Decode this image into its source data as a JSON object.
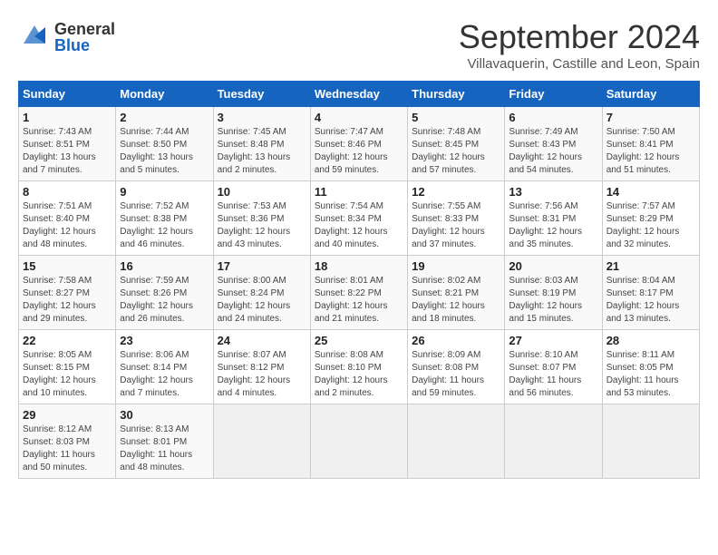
{
  "header": {
    "logo_general": "General",
    "logo_blue": "Blue",
    "month_title": "September 2024",
    "subtitle": "Villavaquerin, Castille and Leon, Spain"
  },
  "days_of_week": [
    "Sunday",
    "Monday",
    "Tuesday",
    "Wednesday",
    "Thursday",
    "Friday",
    "Saturday"
  ],
  "weeks": [
    [
      {
        "day": "1",
        "sunrise": "Sunrise: 7:43 AM",
        "sunset": "Sunset: 8:51 PM",
        "daylight": "Daylight: 13 hours and 7 minutes."
      },
      {
        "day": "2",
        "sunrise": "Sunrise: 7:44 AM",
        "sunset": "Sunset: 8:50 PM",
        "daylight": "Daylight: 13 hours and 5 minutes."
      },
      {
        "day": "3",
        "sunrise": "Sunrise: 7:45 AM",
        "sunset": "Sunset: 8:48 PM",
        "daylight": "Daylight: 13 hours and 2 minutes."
      },
      {
        "day": "4",
        "sunrise": "Sunrise: 7:47 AM",
        "sunset": "Sunset: 8:46 PM",
        "daylight": "Daylight: 12 hours and 59 minutes."
      },
      {
        "day": "5",
        "sunrise": "Sunrise: 7:48 AM",
        "sunset": "Sunset: 8:45 PM",
        "daylight": "Daylight: 12 hours and 57 minutes."
      },
      {
        "day": "6",
        "sunrise": "Sunrise: 7:49 AM",
        "sunset": "Sunset: 8:43 PM",
        "daylight": "Daylight: 12 hours and 54 minutes."
      },
      {
        "day": "7",
        "sunrise": "Sunrise: 7:50 AM",
        "sunset": "Sunset: 8:41 PM",
        "daylight": "Daylight: 12 hours and 51 minutes."
      }
    ],
    [
      {
        "day": "8",
        "sunrise": "Sunrise: 7:51 AM",
        "sunset": "Sunset: 8:40 PM",
        "daylight": "Daylight: 12 hours and 48 minutes."
      },
      {
        "day": "9",
        "sunrise": "Sunrise: 7:52 AM",
        "sunset": "Sunset: 8:38 PM",
        "daylight": "Daylight: 12 hours and 46 minutes."
      },
      {
        "day": "10",
        "sunrise": "Sunrise: 7:53 AM",
        "sunset": "Sunset: 8:36 PM",
        "daylight": "Daylight: 12 hours and 43 minutes."
      },
      {
        "day": "11",
        "sunrise": "Sunrise: 7:54 AM",
        "sunset": "Sunset: 8:34 PM",
        "daylight": "Daylight: 12 hours and 40 minutes."
      },
      {
        "day": "12",
        "sunrise": "Sunrise: 7:55 AM",
        "sunset": "Sunset: 8:33 PM",
        "daylight": "Daylight: 12 hours and 37 minutes."
      },
      {
        "day": "13",
        "sunrise": "Sunrise: 7:56 AM",
        "sunset": "Sunset: 8:31 PM",
        "daylight": "Daylight: 12 hours and 35 minutes."
      },
      {
        "day": "14",
        "sunrise": "Sunrise: 7:57 AM",
        "sunset": "Sunset: 8:29 PM",
        "daylight": "Daylight: 12 hours and 32 minutes."
      }
    ],
    [
      {
        "day": "15",
        "sunrise": "Sunrise: 7:58 AM",
        "sunset": "Sunset: 8:27 PM",
        "daylight": "Daylight: 12 hours and 29 minutes."
      },
      {
        "day": "16",
        "sunrise": "Sunrise: 7:59 AM",
        "sunset": "Sunset: 8:26 PM",
        "daylight": "Daylight: 12 hours and 26 minutes."
      },
      {
        "day": "17",
        "sunrise": "Sunrise: 8:00 AM",
        "sunset": "Sunset: 8:24 PM",
        "daylight": "Daylight: 12 hours and 24 minutes."
      },
      {
        "day": "18",
        "sunrise": "Sunrise: 8:01 AM",
        "sunset": "Sunset: 8:22 PM",
        "daylight": "Daylight: 12 hours and 21 minutes."
      },
      {
        "day": "19",
        "sunrise": "Sunrise: 8:02 AM",
        "sunset": "Sunset: 8:21 PM",
        "daylight": "Daylight: 12 hours and 18 minutes."
      },
      {
        "day": "20",
        "sunrise": "Sunrise: 8:03 AM",
        "sunset": "Sunset: 8:19 PM",
        "daylight": "Daylight: 12 hours and 15 minutes."
      },
      {
        "day": "21",
        "sunrise": "Sunrise: 8:04 AM",
        "sunset": "Sunset: 8:17 PM",
        "daylight": "Daylight: 12 hours and 13 minutes."
      }
    ],
    [
      {
        "day": "22",
        "sunrise": "Sunrise: 8:05 AM",
        "sunset": "Sunset: 8:15 PM",
        "daylight": "Daylight: 12 hours and 10 minutes."
      },
      {
        "day": "23",
        "sunrise": "Sunrise: 8:06 AM",
        "sunset": "Sunset: 8:14 PM",
        "daylight": "Daylight: 12 hours and 7 minutes."
      },
      {
        "day": "24",
        "sunrise": "Sunrise: 8:07 AM",
        "sunset": "Sunset: 8:12 PM",
        "daylight": "Daylight: 12 hours and 4 minutes."
      },
      {
        "day": "25",
        "sunrise": "Sunrise: 8:08 AM",
        "sunset": "Sunset: 8:10 PM",
        "daylight": "Daylight: 12 hours and 2 minutes."
      },
      {
        "day": "26",
        "sunrise": "Sunrise: 8:09 AM",
        "sunset": "Sunset: 8:08 PM",
        "daylight": "Daylight: 11 hours and 59 minutes."
      },
      {
        "day": "27",
        "sunrise": "Sunrise: 8:10 AM",
        "sunset": "Sunset: 8:07 PM",
        "daylight": "Daylight: 11 hours and 56 minutes."
      },
      {
        "day": "28",
        "sunrise": "Sunrise: 8:11 AM",
        "sunset": "Sunset: 8:05 PM",
        "daylight": "Daylight: 11 hours and 53 minutes."
      }
    ],
    [
      {
        "day": "29",
        "sunrise": "Sunrise: 8:12 AM",
        "sunset": "Sunset: 8:03 PM",
        "daylight": "Daylight: 11 hours and 50 minutes."
      },
      {
        "day": "30",
        "sunrise": "Sunrise: 8:13 AM",
        "sunset": "Sunset: 8:01 PM",
        "daylight": "Daylight: 11 hours and 48 minutes."
      },
      null,
      null,
      null,
      null,
      null
    ]
  ]
}
